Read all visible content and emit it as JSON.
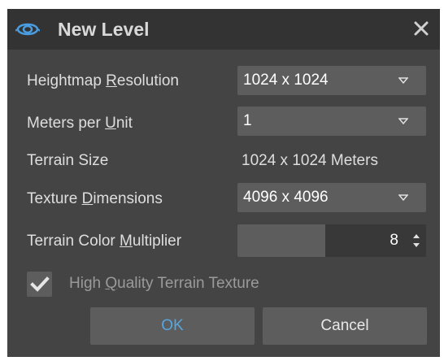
{
  "dialog": {
    "title": "New Level",
    "title_icon": "eye-icon",
    "close_icon": "close-icon"
  },
  "rows": {
    "heightmap": {
      "label_pre": "Heightmap ",
      "label_key": "R",
      "label_post": "esolution",
      "value": "1024 x 1024"
    },
    "meters": {
      "label_pre": "Meters per ",
      "label_key": "U",
      "label_post": "nit",
      "value": "1"
    },
    "terrain_size": {
      "label": "Terrain Size",
      "value": "1024 x 1024 Meters"
    },
    "texture": {
      "label_pre": "Texture ",
      "label_key": "D",
      "label_post": "imensions",
      "value": "4096 x 4096"
    },
    "multiplier": {
      "label_pre": "Terrain Color ",
      "label_key": "M",
      "label_post": "ultiplier",
      "value": "8"
    }
  },
  "high_quality": {
    "label_pre": "High ",
    "label_key": "Q",
    "label_post": "uality Terrain Texture",
    "checked": true
  },
  "buttons": {
    "ok": "OK",
    "cancel": "Cancel"
  },
  "colors": {
    "dialog_bg": "#444444",
    "titlebar_bg": "#333333",
    "control_bg": "#5d5d5d",
    "accent": "#58a6de",
    "icon_blue": "#4a9de0"
  }
}
